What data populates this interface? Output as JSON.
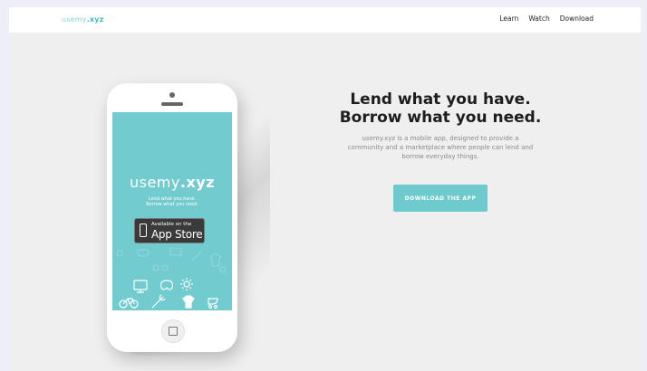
{
  "nav": {
    "brand_prefix": "usemy",
    "brand_suffix": ".xyz",
    "links": [
      "Learn",
      "Watch",
      "Download"
    ]
  },
  "phone": {
    "logo_prefix": "usemy",
    "logo_suffix": ".xyz",
    "tagline_1": "Lend what you have.",
    "tagline_2": "Borrow what you need.",
    "badge_small": "Available on the",
    "badge_big": "App Store"
  },
  "hero": {
    "headline_1": "Lend what you have.",
    "headline_2": "Borrow what you need.",
    "subtext": "usemy.xyz is a mobile app, designed to provide a community and a marketplace where people can lend and borrow everyday things.",
    "cta_label": "DOWNLOAD THE APP"
  },
  "colors": {
    "accent": "#6fcace",
    "brand": "#46b8c0",
    "headline": "#1d1d1d"
  },
  "icons": [
    "monitor-icon",
    "wrench-icon",
    "gamepad-icon",
    "sun-icon",
    "bicycle-icon",
    "tshirt-icon",
    "stroller-icon"
  ]
}
